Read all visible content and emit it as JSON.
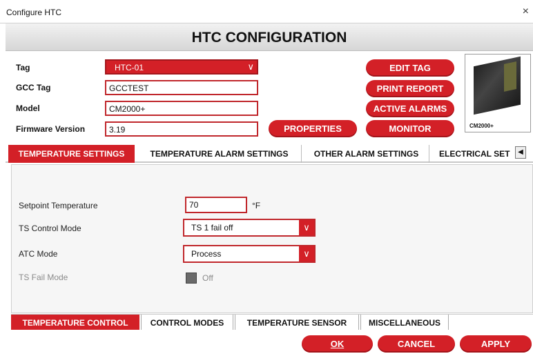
{
  "window": {
    "title": "Configure HTC",
    "close_glyph": "×"
  },
  "header": {
    "title": "HTC CONFIGURATION"
  },
  "form": {
    "tag_label": "Tag",
    "tag_value": "HTC-01",
    "gcc_label": "GCC Tag",
    "gcc_value": "GCCTEST",
    "model_label": "Model",
    "model_value": "CM2000+",
    "firmware_label": "Firmware Version",
    "firmware_value": "3.19"
  },
  "actions": {
    "edit_tag": "EDIT TAG",
    "print_report": "PRINT REPORT",
    "active_alarms": "ACTIVE ALARMS",
    "monitor": "MONITOR",
    "properties": "PROPERTIES"
  },
  "device": {
    "caption": "CM2000+"
  },
  "tabs": [
    {
      "label": "TEMPERATURE SETTINGS"
    },
    {
      "label": "TEMPERATURE ALARM SETTINGS"
    },
    {
      "label": "OTHER ALARM SETTINGS"
    },
    {
      "label": "ELECTRICAL SET"
    }
  ],
  "temperature": {
    "setpoint_label": "Setpoint Temperature",
    "setpoint_value": "70",
    "setpoint_unit": "°F",
    "ts_control_label": "TS Control Mode",
    "ts_control_value": "TS 1 fail off",
    "atc_label": "ATC Mode",
    "atc_value": "Process",
    "ts_fail_label": "TS Fail Mode",
    "ts_fail_value": "Off"
  },
  "subtabs": [
    {
      "label": "TEMPERATURE CONTROL"
    },
    {
      "label": "CONTROL MODES"
    },
    {
      "label": "TEMPERATURE SENSOR"
    },
    {
      "label": "MISCELLANEOUS"
    }
  ],
  "footer": {
    "ok": "OK",
    "cancel": "CANCEL",
    "apply": "APPLY"
  },
  "icons": {
    "dropdown": "chevron-down-icon",
    "tab_prev": "◀",
    "tab_next": "▶"
  },
  "colors": {
    "accent": "#d32027",
    "accent_dark": "#a3161c"
  }
}
